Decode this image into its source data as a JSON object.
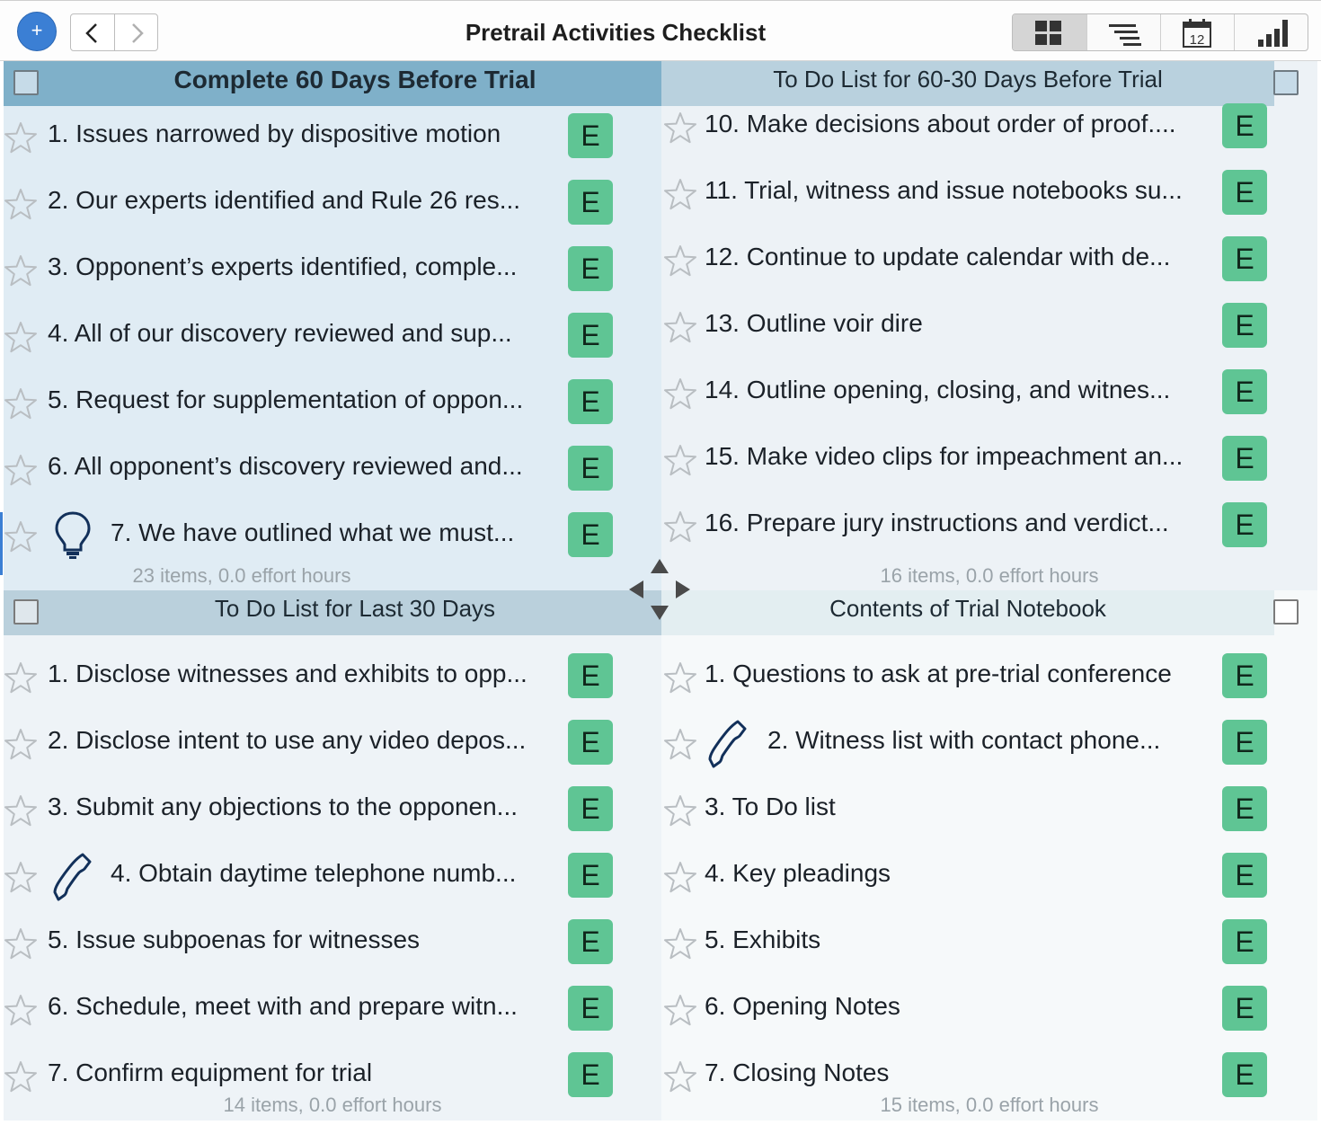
{
  "window": {
    "title": "Pretrail Activities Checklist",
    "add_symbol": "+",
    "nav": [
      "chevron-left-icon",
      "chevron-right-icon"
    ],
    "views": [
      {
        "name": "grid-view-icon",
        "active": true
      },
      {
        "name": "outline-view-icon",
        "active": false
      },
      {
        "name": "calendar-view-icon",
        "active": false,
        "label": "12"
      },
      {
        "name": "chart-view-icon",
        "active": false
      }
    ]
  },
  "colors": {
    "accent": "#3b7fd4",
    "badge": "#5fc594",
    "q1_header": "#7fb0c9",
    "q2_header": "#b9d1de",
    "q3_header": "#bad0dc",
    "q4_header": "#e3eef1"
  },
  "quadrants": {
    "q1": {
      "title": "Complete 60 Days Before Trial",
      "summary": "23 items, 0.0 effort hours",
      "items": [
        {
          "text": "1. Issues narrowed by dispositive motion",
          "badge": "E"
        },
        {
          "text": "2. Our experts identified and Rule 26 res...",
          "badge": "E"
        },
        {
          "text": "3. Opponent’s experts identified, comple...",
          "badge": "E"
        },
        {
          "text": "4. All of our discovery reviewed and sup...",
          "badge": "E"
        },
        {
          "text": "5. Request for supplementation of oppon...",
          "badge": "E"
        },
        {
          "text": "6. All opponent’s discovery reviewed and...",
          "badge": "E"
        },
        {
          "text": "7. We have outlined what we must...",
          "badge": "E",
          "icon": "lightbulb-icon"
        }
      ]
    },
    "q2": {
      "title": "To Do List for 60-30 Days Before Trial",
      "summary": "16 items, 0.0 effort hours",
      "items": [
        {
          "text": "10. Make decisions about order of proof....",
          "badge": "E"
        },
        {
          "text": "11. Trial, witness and issue notebooks su...",
          "badge": "E"
        },
        {
          "text": "12. Continue to update calendar with de...",
          "badge": "E"
        },
        {
          "text": "13. Outline voir dire",
          "badge": "E"
        },
        {
          "text": "14. Outline opening, closing, and witnes...",
          "badge": "E"
        },
        {
          "text": "15. Make video clips for impeachment an...",
          "badge": "E"
        },
        {
          "text": "16. Prepare jury instructions and verdict...",
          "badge": "E"
        }
      ]
    },
    "q3": {
      "title": "To Do List for Last 30 Days",
      "summary": "14 items, 0.0 effort hours",
      "items": [
        {
          "text": "1. Disclose witnesses and exhibits to opp...",
          "badge": "E"
        },
        {
          "text": "2. Disclose intent to use any video depos...",
          "badge": "E"
        },
        {
          "text": "3. Submit any objections to the opponen...",
          "badge": "E"
        },
        {
          "text": "4. Obtain daytime telephone numb...",
          "badge": "E",
          "icon": "phone-icon"
        },
        {
          "text": "5. Issue subpoenas for witnesses",
          "badge": "E"
        },
        {
          "text": "6. Schedule, meet with and prepare witn...",
          "badge": "E"
        },
        {
          "text": "7. Confirm equipment for trial",
          "badge": "E"
        }
      ]
    },
    "q4": {
      "title": "Contents of Trial Notebook",
      "summary": "15 items, 0.0 effort hours",
      "items": [
        {
          "text": "1. Questions to ask at pre-trial conference",
          "badge": "E"
        },
        {
          "text": "2. Witness list with contact phone...",
          "badge": "E",
          "icon": "phone-icon"
        },
        {
          "text": "3. To Do list",
          "badge": "E"
        },
        {
          "text": "4. Key pleadings",
          "badge": "E"
        },
        {
          "text": "5. Exhibits",
          "badge": "E"
        },
        {
          "text": "6. Opening Notes",
          "badge": "E"
        },
        {
          "text": "7. Closing Notes",
          "badge": "E"
        }
      ]
    }
  }
}
